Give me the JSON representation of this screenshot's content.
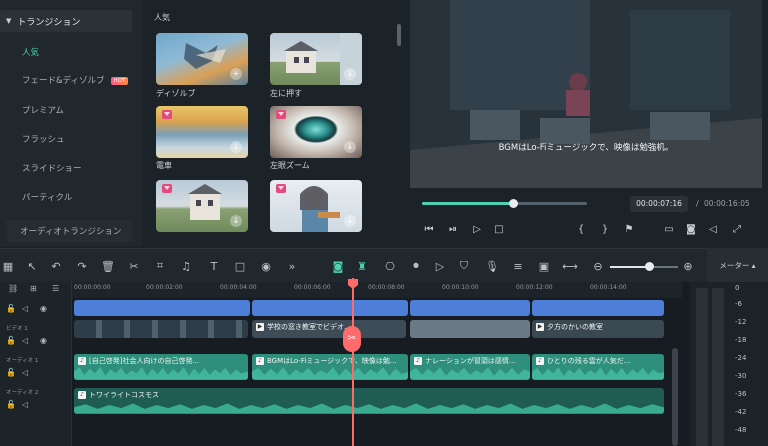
{
  "categories": {
    "header": "トランジション",
    "items": [
      {
        "label": "人気",
        "active": true,
        "badge": ""
      },
      {
        "label": "フェード&ディゾルブ",
        "active": false,
        "badge": "HOT"
      },
      {
        "label": "プレミアム",
        "active": false,
        "badge": ""
      },
      {
        "label": "フラッシュ",
        "active": false,
        "badge": ""
      },
      {
        "label": "スライドショー",
        "active": false,
        "badge": ""
      },
      {
        "label": "パーティクル",
        "active": false,
        "badge": ""
      }
    ],
    "audio_section": "オーディオトランジション"
  },
  "grid": {
    "title": "人気",
    "thumbs": [
      {
        "label": "ディゾルブ",
        "premium": false,
        "action": "add-icon"
      },
      {
        "label": "左に押す",
        "premium": false,
        "action": "download-icon"
      },
      {
        "label": "電車",
        "premium": true,
        "action": "download-icon"
      },
      {
        "label": "左眼ズーム",
        "premium": true,
        "action": "download-icon"
      },
      {
        "label": "",
        "premium": true,
        "action": "download-icon"
      },
      {
        "label": "",
        "premium": true,
        "action": "download-icon"
      }
    ]
  },
  "preview": {
    "subtitle": "BGMはLo-Fiミュージックで、映像は勉強机。",
    "current_time": "00:00:07:16",
    "separator": "/",
    "total_time": "00:00:16:05",
    "progress": 0.55
  },
  "toolbar": {
    "meter_label": "メーター ▴"
  },
  "timeline": {
    "ruler": [
      "00:00:00:00",
      "00:00:02:00",
      "00:00:04:00",
      "00:00:06:00",
      "00:00:08:00",
      "00:00:10:00",
      "00:00:12:00",
      "00:00:14:00"
    ],
    "tracks": {
      "video_label": "ビデオ 1",
      "audio1_label": "オーディオ 1",
      "audio2_label": "オーディオ 2"
    },
    "video_clips": [
      "",
      "学校の窓き教室でビデオ...",
      "",
      "夕方のかいの教室"
    ],
    "audio_clips": [
      "[自己啓発]社会人向けの自己啓発...",
      "BGMはLo-Fiミュージックで、映像は勉...",
      "ナレーションが冒頭は感情...",
      "ひとりの残る雲が人気だ..."
    ],
    "music_clip": "トワイライトコスモス"
  },
  "meter": {
    "ticks": [
      "0",
      "-6",
      "-12",
      "-18",
      "-24",
      "-30",
      "-36",
      "-42",
      "-48"
    ]
  },
  "colors": {
    "accent": "#4fd0b0",
    "playhead": "#ff6b6b",
    "video_clip": "#4d7ed8",
    "audio_clip": "#2e8f7c"
  }
}
